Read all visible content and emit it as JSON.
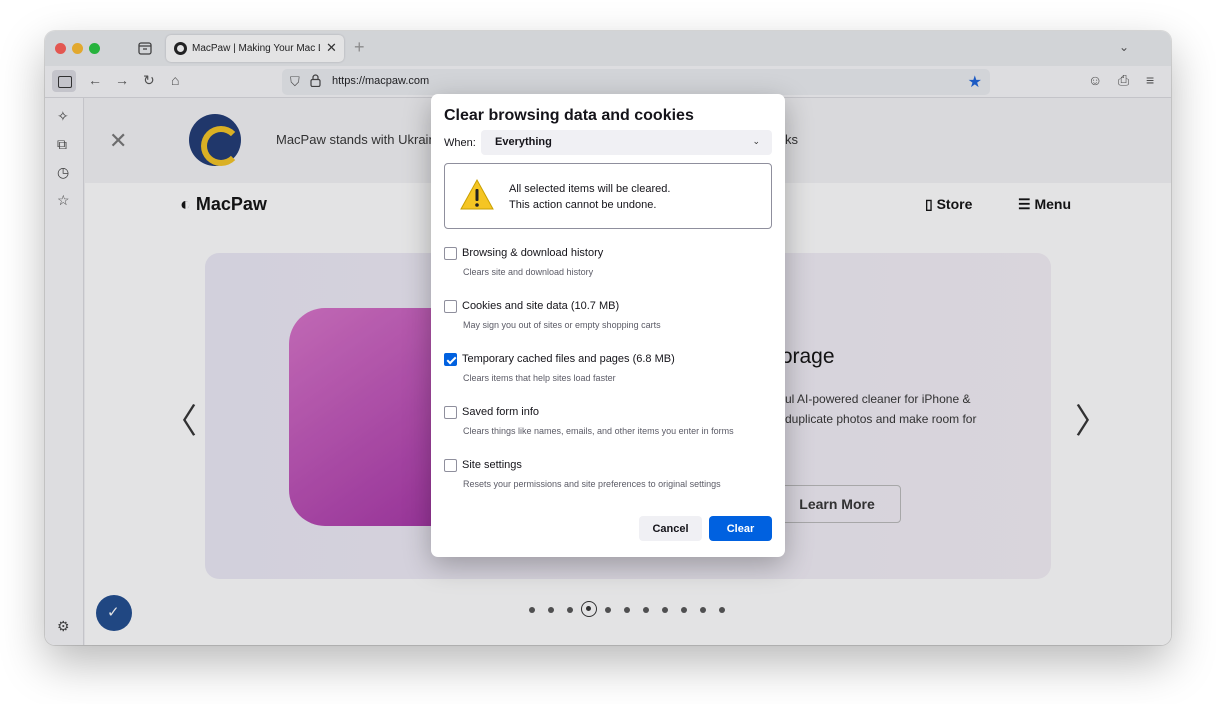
{
  "browser": {
    "tab": {
      "title": "MacPaw | Making Your Mac Life",
      "close": "✕"
    },
    "new_tab": "+",
    "tab_list": "⌄",
    "nav": {
      "back": "←",
      "forward": "→",
      "reload": "↻",
      "home": "⌂"
    },
    "url": "https://macpaw.com",
    "toolbar_icons": {
      "account": "☺",
      "share": "⎙",
      "app_menu": "≡"
    }
  },
  "sidebar": {
    "icons": [
      "ai-chatbot-icon",
      "synced-tabs-icon",
      "history-icon",
      "bookmarks-icon",
      "settings-icon"
    ]
  },
  "page": {
    "banner": {
      "text": "MacPaw stands with Ukrain",
      "text_right": "ks",
      "close": "✕"
    },
    "brand": "MacPaw",
    "nav": {
      "store": "Store",
      "menu": "Menu"
    },
    "hero": {
      "title": "torage",
      "desc_line1": "eful AI-powered cleaner for iPhone &",
      "desc_line2": "e duplicate photos and make room for",
      "cta": "Learn More",
      "prev": "〈",
      "next": "〉"
    },
    "carousel": {
      "total": 11,
      "active_index": 3
    }
  },
  "dialog": {
    "title": "Clear browsing data and cookies",
    "when_label": "When:",
    "when_value": "Everything",
    "warning_line1": "All selected items will be cleared.",
    "warning_line2": "This action cannot be undone.",
    "options": [
      {
        "label": "Browsing & download history",
        "desc": "Clears site and download history",
        "checked": false
      },
      {
        "label": "Cookies and site data (10.7 MB)",
        "desc": "May sign you out of sites or empty shopping carts",
        "checked": false
      },
      {
        "label": "Temporary cached files and pages (6.8 MB)",
        "desc": "Clears items that help sites load faster",
        "checked": true
      },
      {
        "label": "Saved form info",
        "desc": "Clears things like names, emails, and other items you enter in forms",
        "checked": false
      },
      {
        "label": "Site settings",
        "desc": "Resets your permissions and site preferences to original settings",
        "checked": false
      }
    ],
    "cancel": "Cancel",
    "clear": "Clear"
  },
  "colors": {
    "accent": "#0061e0",
    "warning": "#f5c523",
    "brand_blue": "#1f3a75"
  }
}
